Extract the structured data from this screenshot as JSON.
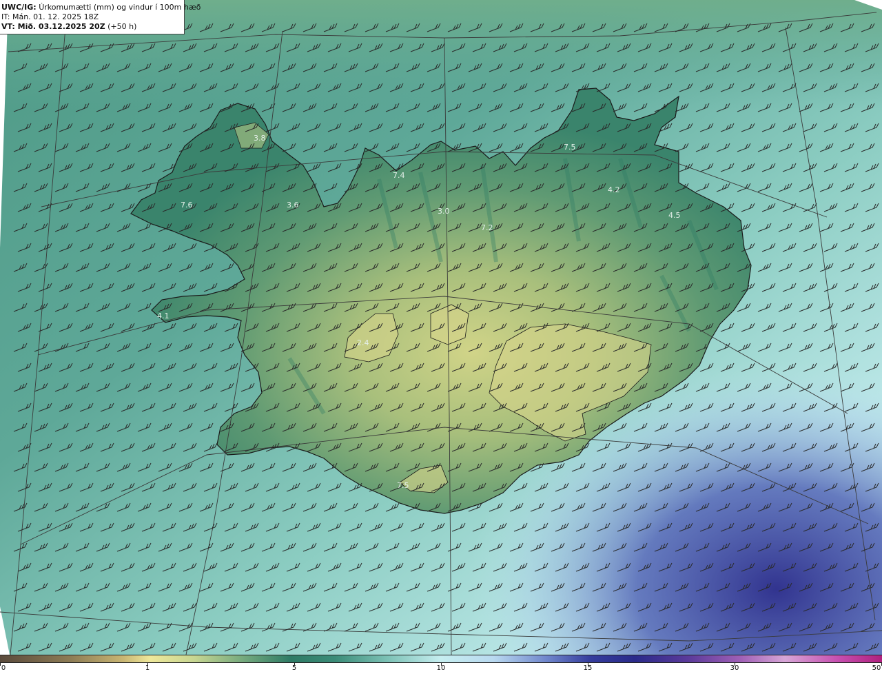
{
  "header": {
    "title_prefix": "UWC/IG:",
    "title_text": "Úrkomumætti (mm) og vindur í 100m hæð",
    "initial_time": "IT: Mán. 01. 12. 2025 18Z",
    "valid_prefix": "VT: Mið. 03.12.2025 20Z",
    "valid_suffix": "(+50 h)"
  },
  "map_labels": [
    "3.8",
    "7.4",
    "7.5",
    "4.2",
    "4.5",
    "3.0",
    "7.2",
    "7.6",
    "3.6",
    "4.1",
    "2.4",
    "7.5"
  ],
  "colorbar": {
    "tick_labels": [
      "0",
      "1",
      "5",
      "10",
      "15",
      "30",
      "50"
    ],
    "colors": [
      "#5a4a3c",
      "#efe89a",
      "#2e7a65",
      "#c6eef0",
      "#2a2a8a",
      "#d7a6d7",
      "#b0207e"
    ]
  },
  "colors": {
    "sea": "#5ea898",
    "land_low": "#3f8a72",
    "land_high": "#c9cf86",
    "coast": "#1a1a1a",
    "barb": "#2a2a2a",
    "grid": "#3a3a3a"
  }
}
